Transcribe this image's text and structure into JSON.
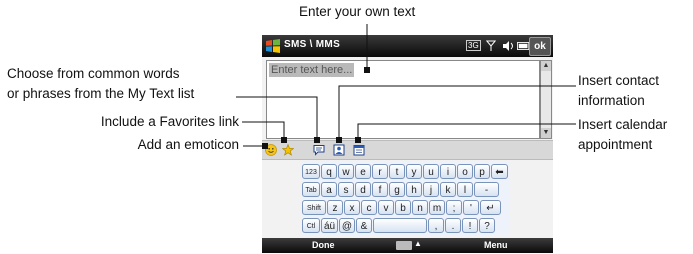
{
  "callouts": {
    "top": "Enter your own text",
    "mytext_line1": "Choose from common words",
    "mytext_line2": "or phrases from the My Text list",
    "favorites": "Include a Favorites link",
    "emoticon": "Add an emoticon",
    "contact_line1": "Insert contact",
    "contact_line2": "information",
    "calendar_line1": "Insert calendar",
    "calendar_line2": "appointment"
  },
  "phone": {
    "title": "SMS \\ MMS",
    "status_3g": "3G",
    "ok_label": "ok",
    "placeholder": "Enter text here...",
    "toolbar_icons": [
      "emoticon-icon",
      "favorites-icon",
      "my-text-icon",
      "contact-icon",
      "calendar-icon"
    ],
    "keyboard_rows": [
      [
        "123",
        "q",
        "w",
        "e",
        "r",
        "t",
        "y",
        "u",
        "i",
        "o",
        "p",
        "⬅"
      ],
      [
        "Tab",
        "a",
        "s",
        "d",
        "f",
        "g",
        "h",
        "j",
        "k",
        "l",
        "-"
      ],
      [
        "Shift",
        "z",
        "x",
        "c",
        "v",
        "b",
        "n",
        "m",
        ";",
        "'",
        "↵"
      ],
      [
        "Ctl",
        "áü",
        "@",
        "&",
        " ",
        ",",
        ".",
        "!",
        "?"
      ]
    ],
    "menu_left": "Done",
    "menu_right": "Menu"
  },
  "colors": {
    "titlebar": "#1a1a1a",
    "key_border": "#7a93b8",
    "accent_windows": "#e8a000"
  }
}
